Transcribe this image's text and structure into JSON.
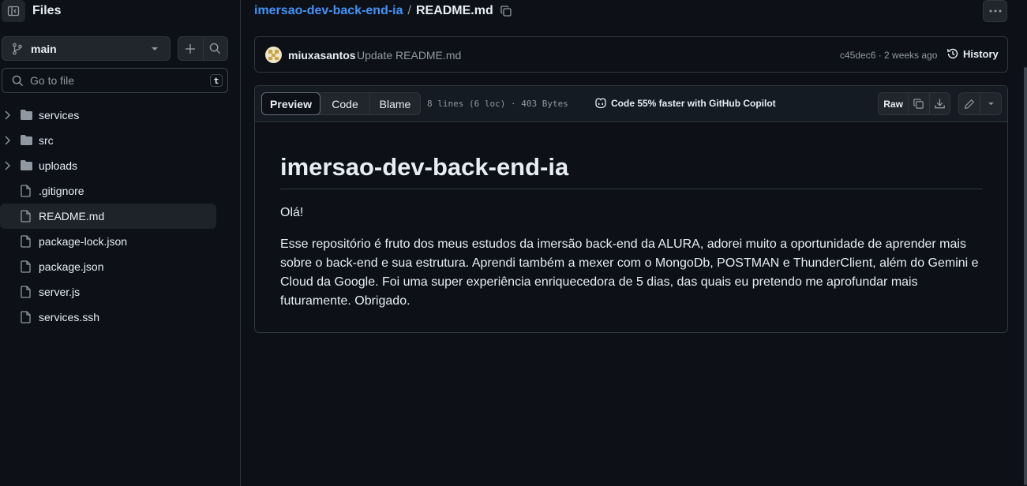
{
  "sidebar": {
    "title": "Files",
    "branch": "main",
    "search_placeholder": "Go to file",
    "search_shortcut": "t",
    "items": [
      {
        "label": "services",
        "type": "folder"
      },
      {
        "label": "src",
        "type": "folder"
      },
      {
        "label": "uploads",
        "type": "folder"
      },
      {
        "label": ".gitignore",
        "type": "file"
      },
      {
        "label": "README.md",
        "type": "file",
        "active": true
      },
      {
        "label": "package-lock.json",
        "type": "file"
      },
      {
        "label": "package.json",
        "type": "file"
      },
      {
        "label": "server.js",
        "type": "file"
      },
      {
        "label": "services.ssh",
        "type": "file"
      }
    ]
  },
  "breadcrumb": {
    "repo": "imersao-dev-back-end-ia",
    "separator": "/",
    "file": "README.md"
  },
  "commit": {
    "author": "miuxasantos",
    "message": "Update README.md",
    "meta": "c45dec6 · 2 weeks ago",
    "history_label": "History"
  },
  "file_view": {
    "tabs": [
      "Preview",
      "Code",
      "Blame"
    ],
    "active_tab": "Preview",
    "stats": "8 lines (6 loc) · 403 Bytes",
    "copilot_text": "Code 55% faster with GitHub Copilot",
    "raw_label": "Raw"
  },
  "readme": {
    "heading": "imersao-dev-back-end-ia",
    "greeting": "Olá!",
    "body": "Esse repositório é fruto dos meus estudos da imersão back-end da ALURA, adorei muito a oportunidade de aprender mais sobre o back-end e sua estrutura. Aprendi também a mexer com o MongoDb, POSTMAN e ThunderClient, além do Gemini e Cloud da Google. Foi uma super experiência enriquecedora de 5 dias, das quais eu pretendo me aprofundar mais futuramente. Obrigado."
  },
  "colors": {
    "background": "#0d1117",
    "border": "#30363d",
    "link": "#4493f8",
    "muted": "#9198a1"
  }
}
